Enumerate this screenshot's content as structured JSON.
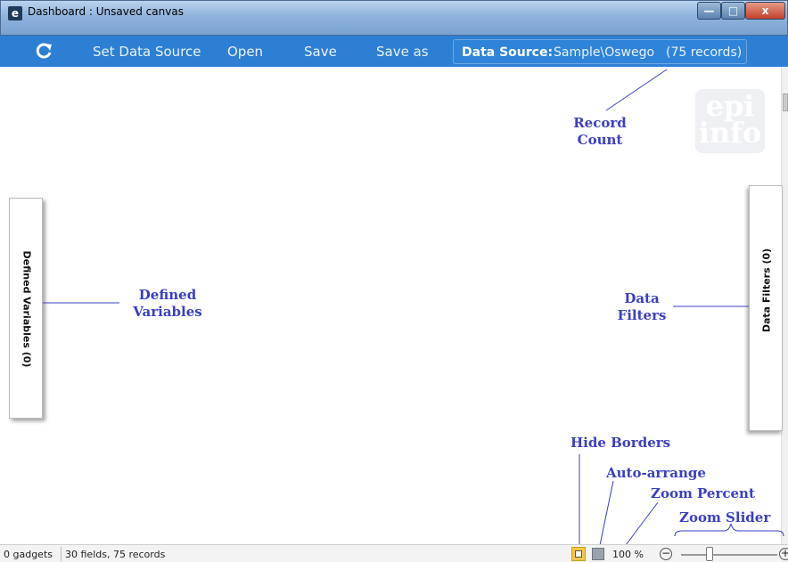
{
  "window": {
    "app_icon_glyph": "e",
    "title": "Dashboard : Unsaved canvas",
    "min_glyph": "—",
    "max_glyph": "□",
    "close_glyph": "x"
  },
  "toolbar": {
    "refresh_icon": "refresh-icon",
    "set_data_source": "Set Data Source",
    "open": "Open",
    "save": "Save",
    "save_as": "Save as",
    "data_source_label": "Data Source:",
    "data_source_value": "Sample\\Oswego",
    "record_count": "(75 records)"
  },
  "canvas": {
    "logo_line1": "epi",
    "logo_line2": "info",
    "left_panel_label": "Defined Variables (0)",
    "right_panel_label": "Data Filters (0)"
  },
  "annotations": {
    "record_count_1": "Record",
    "record_count_2": "Count",
    "defined_variables_1": "Defined",
    "defined_variables_2": "Variables",
    "data_filters_1": "Data",
    "data_filters_2": "Filters",
    "hide_borders": "Hide Borders",
    "auto_arrange": "Auto-arrange",
    "zoom_percent": "Zoom Percent",
    "zoom_slider": "Zoom Slider"
  },
  "statusbar": {
    "gadgets": "0 gadgets",
    "fields": "30 fields, 75 records",
    "zoom_percent": "100 %",
    "zoom_out": "−",
    "zoom_in": "+"
  },
  "colors": {
    "toolbar": "#2d7fd3",
    "annotation": "#3b3fc4",
    "hide_borders_active": "#f5c84a"
  }
}
